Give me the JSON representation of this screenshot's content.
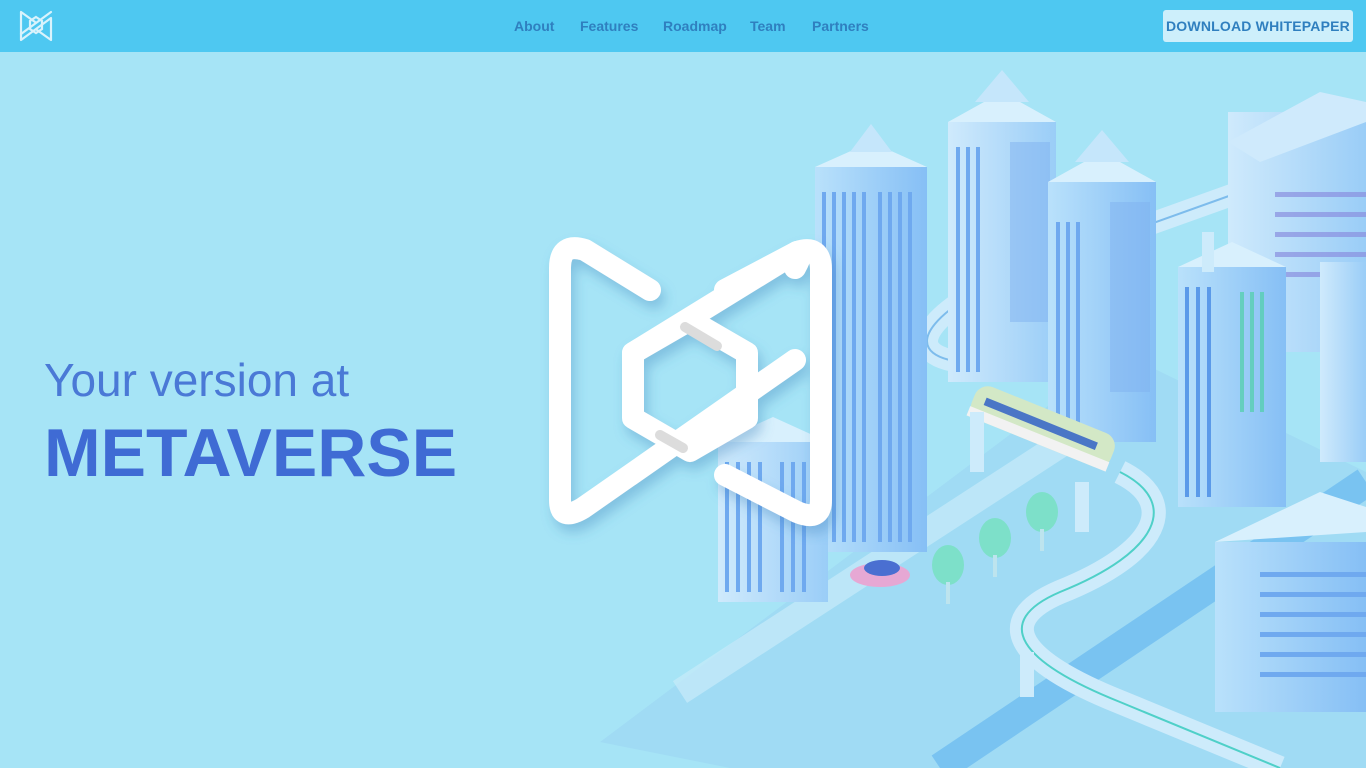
{
  "header": {
    "logo_icon": "metaverse-bowtie-logo",
    "nav": [
      {
        "label": "About"
      },
      {
        "label": "Features"
      },
      {
        "label": "Roadmap"
      },
      {
        "label": "Team"
      },
      {
        "label": "Partners"
      }
    ],
    "cta_label": "DOWNLOAD WHITEPAPER"
  },
  "hero": {
    "subtitle": "Your version at",
    "title": "METAVERSE",
    "center_icon": "metaverse-bowtie-logo",
    "illustration": "isometric-city"
  },
  "colors": {
    "header_bg": "#4ec8f1",
    "page_bg": "#a6e4f6",
    "nav_text": "#2f7fbf",
    "title": "#3f6bd4",
    "button_bg": "#cdeffb"
  }
}
